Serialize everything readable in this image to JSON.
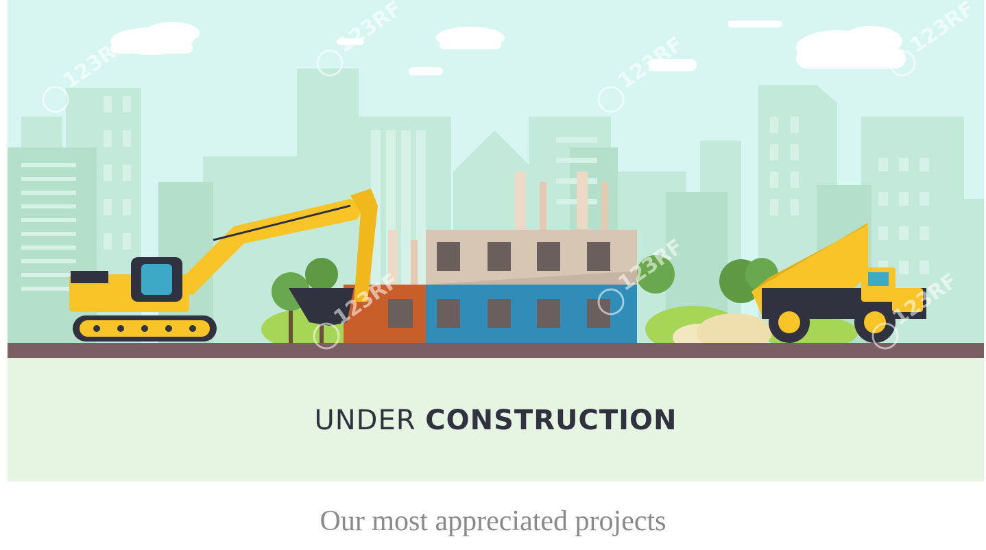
{
  "hero": {
    "title_light": "UNDER",
    "title_bold": "CONSTRUCTION",
    "watermark": "123RF",
    "illustration": "construction site with excavator, building under construction and dump truck in front of city skyline",
    "colors": {
      "sky": "#d8f6f1",
      "skyline": "#b7e3d0",
      "ground_band": "#ecf8ea",
      "road": "#7a5e63",
      "machine_yellow": "#f8c427",
      "text_dark": "#30323f"
    }
  },
  "content": {
    "section_heading": "Our most appreciated projects"
  }
}
